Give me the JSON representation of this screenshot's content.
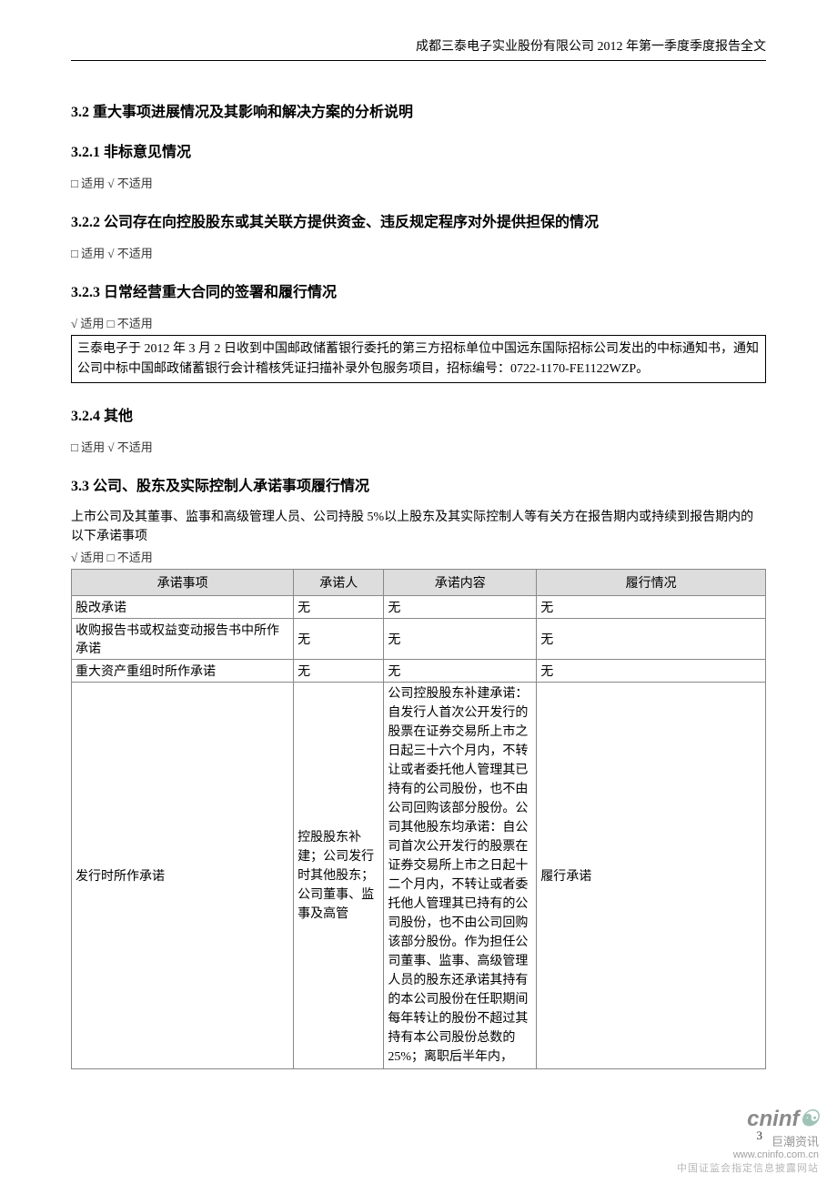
{
  "header": {
    "text": "成都三泰电子实业股份有限公司 2012 年第一季度季度报告全文"
  },
  "sec32": {
    "title": "3.2 重大事项进展情况及其影响和解决方案的分析说明",
    "s321": {
      "title": "3.2.1 非标意见情况",
      "opt": "□ 适用 √ 不适用"
    },
    "s322": {
      "title": "3.2.2 公司存在向控股股东或其关联方提供资金、违反规定程序对外提供担保的情况",
      "opt": "□ 适用 √ 不适用"
    },
    "s323": {
      "title": "3.2.3 日常经营重大合同的签署和履行情况",
      "opt": "√ 适用 □ 不适用",
      "box": "三泰电子于 2012 年 3 月 2 日收到中国邮政储蓄银行委托的第三方招标单位中国远东国际招标公司发出的中标通知书，通知公司中标中国邮政储蓄银行会计稽核凭证扫描补录外包服务项目，招标编号：0722-1170-FE1122WZP。"
    },
    "s324": {
      "title": "3.2.4 其他",
      "opt": "□ 适用 √ 不适用"
    }
  },
  "sec33": {
    "title": "3.3 公司、股东及实际控制人承诺事项履行情况",
    "intro": "上市公司及其董事、监事和高级管理人员、公司持股 5%以上股东及其实际控制人等有关方在报告期内或持续到报告期内的以下承诺事项",
    "opt": "√ 适用 □ 不适用",
    "headers": {
      "c0": "承诺事项",
      "c1": "承诺人",
      "c2": "承诺内容",
      "c3": "履行情况"
    },
    "rows": [
      {
        "c0": "股改承诺",
        "c1": "无",
        "c2": "无",
        "c3": "无"
      },
      {
        "c0": "收购报告书或权益变动报告书中所作承诺",
        "c1": "无",
        "c2": "无",
        "c3": "无"
      },
      {
        "c0": "重大资产重组时所作承诺",
        "c1": "无",
        "c2": "无",
        "c3": "无"
      },
      {
        "c0": "发行时所作承诺",
        "c1": "控股股东补建；公司发行时其他股东；公司董事、监事及高管",
        "c2": "公司控股股东补建承诺：自发行人首次公开发行的股票在证券交易所上市之日起三十六个月内，不转让或者委托他人管理其已持有的公司股份，也不由公司回购该部分股份。公司其他股东均承诺：自公司首次公开发行的股票在证券交易所上市之日起十二个月内，不转让或者委托他人管理其已持有的公司股份，也不由公司回购该部分股份。作为担任公司董事、监事、高级管理人员的股东还承诺其持有的本公司股份在任职期间每年转让的股份不超过其持有本公司股份总数的25%；离职后半年内，",
        "c3": "履行承诺"
      }
    ]
  },
  "footer": {
    "pageNum": "3",
    "brand": "cninf",
    "brandSub": "巨潮资讯",
    "url": "www.cninfo.com.cn",
    "fine": "中国证监会指定信息披露网站"
  }
}
